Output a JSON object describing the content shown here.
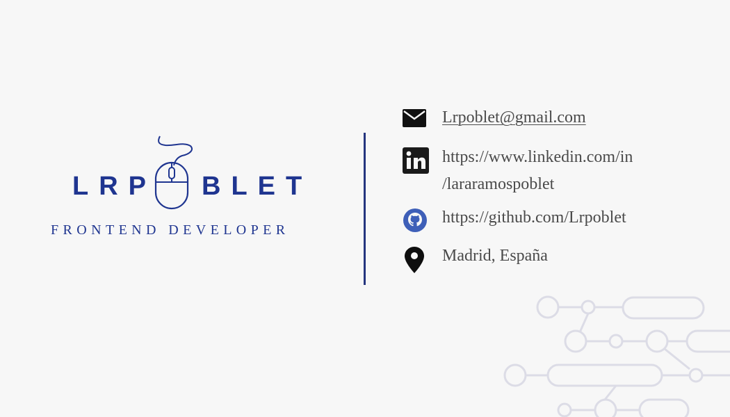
{
  "brand": {
    "name_left": "LRP",
    "name_right": "BLET",
    "tagline": "FRONTEND DEVELOPER",
    "color": "#1f3590"
  },
  "contact": {
    "email": "Lrpoblet@gmail.com",
    "linkedin_line1": "https://www.linkedin.com/in",
    "linkedin_line2": "/lararamospoblet",
    "github": "https://github.com/Lrpoblet",
    "location": "Madrid, España"
  },
  "icons": {
    "logo": "computer-mouse-icon",
    "email": "envelope-icon",
    "linkedin": "linkedin-icon",
    "github": "github-icon",
    "location": "map-pin-icon",
    "decoration": "circuit-pattern"
  },
  "colors": {
    "background": "#f7f7f7",
    "divider": "#25357f",
    "text": "#4a4a4a",
    "icon": "#111111",
    "github": "#3e5fb8",
    "circuit": "#dcdce6"
  }
}
